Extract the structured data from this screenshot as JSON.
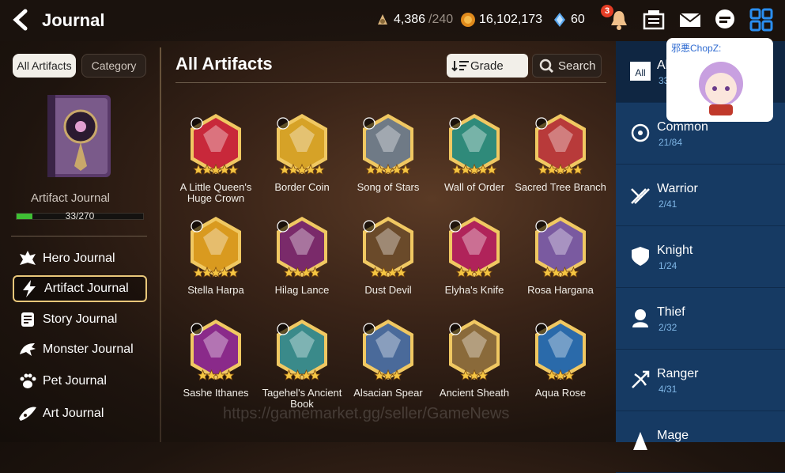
{
  "header": {
    "title": "Journal",
    "resources": [
      {
        "icon": "stamina-icon",
        "value": "4,386",
        "max": "/240"
      },
      {
        "icon": "gold-icon",
        "value": "16,102,173"
      },
      {
        "icon": "skystone-icon",
        "value": "60"
      }
    ],
    "notification_count": "3"
  },
  "left": {
    "tabs": [
      "All Artifacts",
      "Category"
    ],
    "journal_label": "Artifact Journal",
    "progress_text": "33/270",
    "progress_fraction": 0.122,
    "nav": [
      {
        "label": "Hero Journal",
        "icon": "hero-icon"
      },
      {
        "label": "Artifact Journal",
        "icon": "lightning-icon"
      },
      {
        "label": "Story Journal",
        "icon": "scroll-icon"
      },
      {
        "label": "Monster Journal",
        "icon": "dragon-icon"
      },
      {
        "label": "Pet Journal",
        "icon": "paw-icon"
      },
      {
        "label": "Art Journal",
        "icon": "art-icon"
      }
    ]
  },
  "main": {
    "title": "All Artifacts",
    "grade_label": "Grade",
    "search_label": "Search",
    "artifacts": [
      {
        "name": "A Little Queen's Huge Crown",
        "stars": 5,
        "color": "#c8283a"
      },
      {
        "name": "Border Coin",
        "stars": 5,
        "color": "#d6a227"
      },
      {
        "name": "Song of Stars",
        "stars": 5,
        "color": "#6f7a86"
      },
      {
        "name": "Wall of Order",
        "stars": 5,
        "color": "#2f8a7a"
      },
      {
        "name": "Sacred Tree Branch",
        "stars": 5,
        "color": "#b83a3a"
      },
      {
        "name": "Stella Harpa",
        "stars": 5,
        "color": "#d99a1f"
      },
      {
        "name": "Hilag Lance",
        "stars": 4,
        "color": "#7a2a6a"
      },
      {
        "name": "Dust Devil",
        "stars": 4,
        "color": "#6a4a2a"
      },
      {
        "name": "Elyha's Knife",
        "stars": 4,
        "color": "#b0235a"
      },
      {
        "name": "Rosa Hargana",
        "stars": 4,
        "color": "#7a5aa0"
      },
      {
        "name": "Sashe Ithanes",
        "stars": 4,
        "color": "#8a2a8a"
      },
      {
        "name": "Tagehel's Ancient Book",
        "stars": 4,
        "color": "#3a8a8a"
      },
      {
        "name": "Alsacian Spear",
        "stars": 3,
        "color": "#4a6a9a"
      },
      {
        "name": "Ancient Sheath",
        "stars": 3,
        "color": "#8a6a3a"
      },
      {
        "name": "Aqua Rose",
        "stars": 3,
        "color": "#2a6aaa"
      }
    ]
  },
  "categories": [
    {
      "name": "All",
      "count": "33/270",
      "icon": "all-icon"
    },
    {
      "name": "Common",
      "count": "21/84",
      "icon": "common-icon"
    },
    {
      "name": "Warrior",
      "count": "2/41",
      "icon": "warrior-icon"
    },
    {
      "name": "Knight",
      "count": "1/24",
      "icon": "knight-icon"
    },
    {
      "name": "Thief",
      "count": "2/32",
      "icon": "thief-icon"
    },
    {
      "name": "Ranger",
      "count": "4/31",
      "icon": "ranger-icon"
    },
    {
      "name": "Mage",
      "count": "",
      "icon": "mage-icon"
    }
  ],
  "chat": {
    "name": "邪悪ChopZ:"
  },
  "watermark": "https://gamemarket.gg/seller/GameNews"
}
